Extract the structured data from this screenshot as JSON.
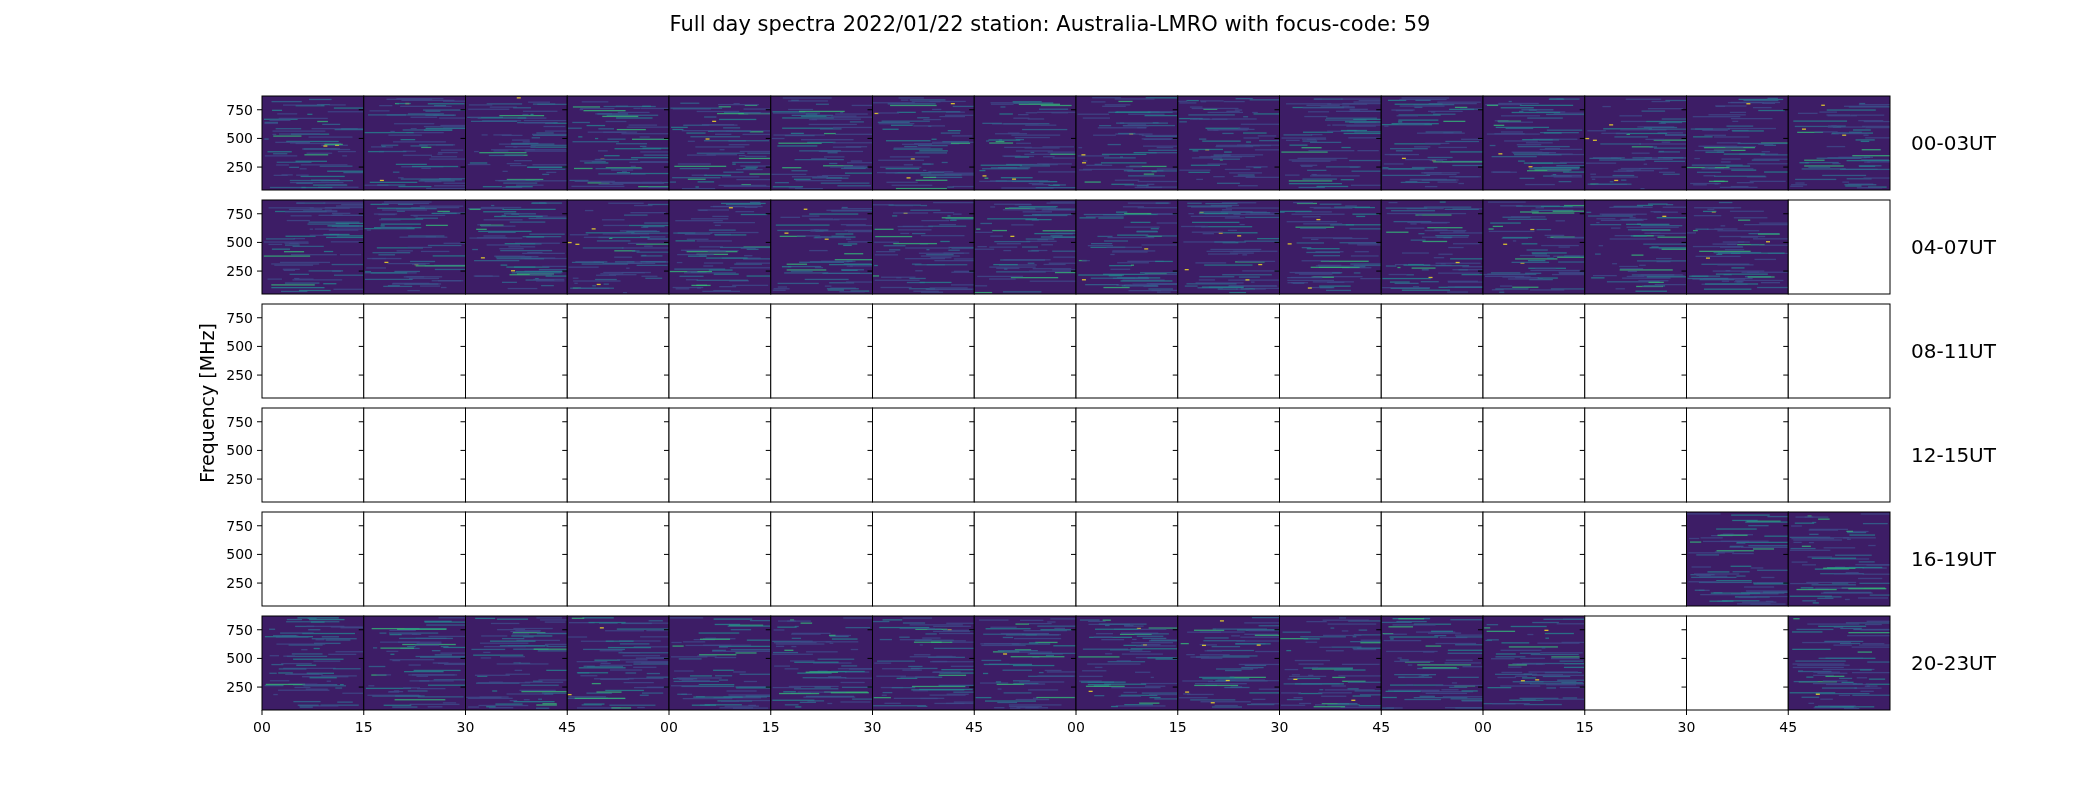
{
  "title": "Full day spectra 2022/01/22 station: Australia-LMRO with focus-code: 59",
  "y_label": "Frequency [MHz]",
  "rows": [
    {
      "label": "00-03UT",
      "y_ticks": [
        "750",
        "500",
        "250"
      ],
      "panels": [
        {
          "has_data": true
        },
        {
          "has_data": true
        },
        {
          "has_data": true
        },
        {
          "has_data": true
        },
        {
          "has_data": true
        },
        {
          "has_data": true
        },
        {
          "has_data": true
        },
        {
          "has_data": true
        },
        {
          "has_data": true
        },
        {
          "has_data": true
        },
        {
          "has_data": true
        },
        {
          "has_data": true
        },
        {
          "has_data": true
        },
        {
          "has_data": true
        },
        {
          "has_data": true
        },
        {
          "has_data": true
        }
      ]
    },
    {
      "label": "04-07UT",
      "y_ticks": [
        "750",
        "500",
        "250"
      ],
      "panels": [
        {
          "has_data": true
        },
        {
          "has_data": true
        },
        {
          "has_data": true
        },
        {
          "has_data": true
        },
        {
          "has_data": true
        },
        {
          "has_data": true
        },
        {
          "has_data": true
        },
        {
          "has_data": true
        },
        {
          "has_data": true
        },
        {
          "has_data": true
        },
        {
          "has_data": true
        },
        {
          "has_data": true
        },
        {
          "has_data": true
        },
        {
          "has_data": true
        },
        {
          "has_data": true
        },
        {
          "has_data": false
        }
      ]
    },
    {
      "label": "08-11UT",
      "y_ticks": [
        "750",
        "500",
        "250"
      ],
      "panels": [
        {
          "has_data": false
        },
        {
          "has_data": false
        },
        {
          "has_data": false
        },
        {
          "has_data": false
        },
        {
          "has_data": false
        },
        {
          "has_data": false
        },
        {
          "has_data": false
        },
        {
          "has_data": false
        },
        {
          "has_data": false
        },
        {
          "has_data": false
        },
        {
          "has_data": false
        },
        {
          "has_data": false
        },
        {
          "has_data": false
        },
        {
          "has_data": false
        },
        {
          "has_data": false
        },
        {
          "has_data": false
        }
      ]
    },
    {
      "label": "12-15UT",
      "y_ticks": [
        "750",
        "500",
        "250"
      ],
      "panels": [
        {
          "has_data": false
        },
        {
          "has_data": false
        },
        {
          "has_data": false
        },
        {
          "has_data": false
        },
        {
          "has_data": false
        },
        {
          "has_data": false
        },
        {
          "has_data": false
        },
        {
          "has_data": false
        },
        {
          "has_data": false
        },
        {
          "has_data": false
        },
        {
          "has_data": false
        },
        {
          "has_data": false
        },
        {
          "has_data": false
        },
        {
          "has_data": false
        },
        {
          "has_data": false
        },
        {
          "has_data": false
        }
      ]
    },
    {
      "label": "16-19UT",
      "y_ticks": [
        "750",
        "500",
        "250"
      ],
      "panels": [
        {
          "has_data": false
        },
        {
          "has_data": false
        },
        {
          "has_data": false
        },
        {
          "has_data": false
        },
        {
          "has_data": false
        },
        {
          "has_data": false
        },
        {
          "has_data": false
        },
        {
          "has_data": false
        },
        {
          "has_data": false
        },
        {
          "has_data": false
        },
        {
          "has_data": false
        },
        {
          "has_data": false
        },
        {
          "has_data": false
        },
        {
          "has_data": false
        },
        {
          "has_data": true
        },
        {
          "has_data": true
        }
      ]
    },
    {
      "label": "20-23UT",
      "y_ticks": [
        "750",
        "500",
        "250"
      ],
      "panels": [
        {
          "has_data": true
        },
        {
          "has_data": true
        },
        {
          "has_data": true
        },
        {
          "has_data": true
        },
        {
          "has_data": true
        },
        {
          "has_data": true
        },
        {
          "has_data": true
        },
        {
          "has_data": true
        },
        {
          "has_data": true
        },
        {
          "has_data": true
        },
        {
          "has_data": true
        },
        {
          "has_data": true
        },
        {
          "has_data": true
        },
        {
          "has_data": false
        },
        {
          "has_data": false
        },
        {
          "has_data": true
        }
      ]
    }
  ],
  "x_ticks": [
    "00",
    "15",
    "30",
    "45",
    "00",
    "15",
    "30",
    "45",
    "00",
    "15",
    "30",
    "45",
    "00",
    "15",
    "30",
    "45"
  ]
}
